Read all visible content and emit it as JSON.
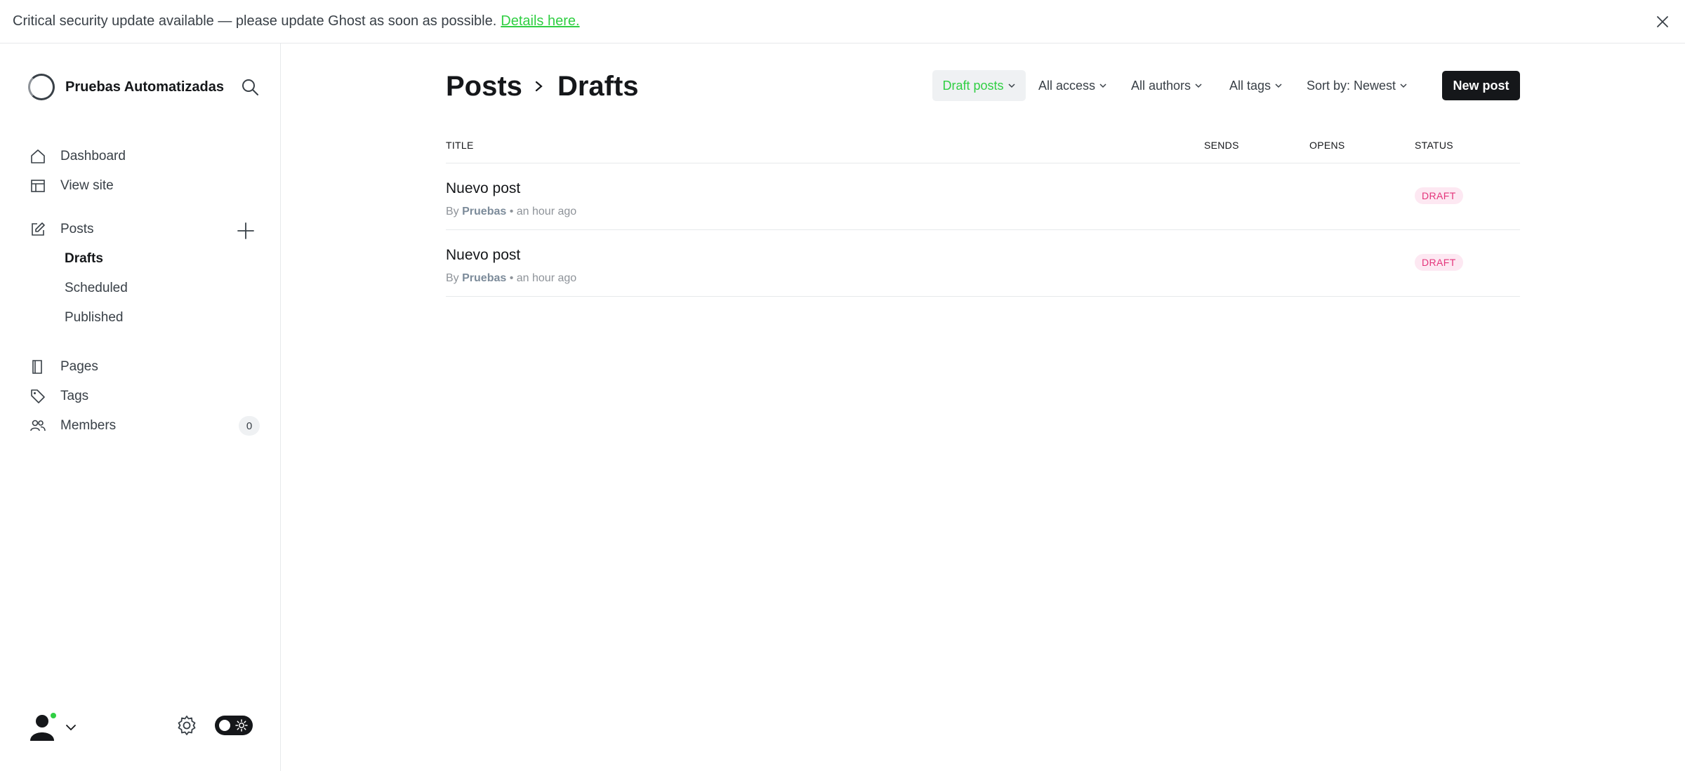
{
  "banner": {
    "message": "Critical security update available — please update Ghost as soon as possible.",
    "link_label": "Details here."
  },
  "sidebar": {
    "site_name": "Pruebas Automatizadas",
    "nav": {
      "dashboard": "Dashboard",
      "view_site": "View site",
      "posts": "Posts",
      "drafts": "Drafts",
      "scheduled": "Scheduled",
      "published": "Published",
      "pages": "Pages",
      "tags": "Tags",
      "members": "Members",
      "members_count": "0"
    }
  },
  "header": {
    "breadcrumb_parent": "Posts",
    "title": "Drafts"
  },
  "filters": {
    "type": "Draft posts",
    "access": "All access",
    "authors": "All authors",
    "tags": "All tags",
    "sort": "Sort by: Newest",
    "new_post": "New post"
  },
  "table": {
    "columns": [
      "TITLE",
      "SENDS",
      "OPENS",
      "STATUS"
    ],
    "rows": [
      {
        "title": "Nuevo post",
        "by": "By",
        "author": "Pruebas",
        "time": "• an hour ago",
        "status": "DRAFT"
      },
      {
        "title": "Nuevo post",
        "by": "By",
        "author": "Pruebas",
        "time": "• an hour ago",
        "status": "DRAFT"
      }
    ]
  },
  "colors": {
    "accent_green": "#30cf43",
    "draft_pink": "#e4347b",
    "draft_pink_bg": "#fde8f2",
    "text_dark": "#15171a"
  },
  "icons": [
    "close-icon",
    "search-icon",
    "home-icon",
    "layout-icon",
    "edit-icon",
    "plus-icon",
    "book-icon",
    "tag-icon",
    "users-icon",
    "avatar-icon",
    "chevron-down-icon",
    "gear-icon",
    "sun-icon",
    "chevron-right-icon"
  ]
}
